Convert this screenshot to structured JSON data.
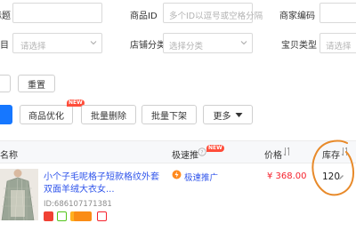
{
  "filters": {
    "title_label": "标题",
    "product_id_label": "商品ID",
    "product_id_placeholder": "多个ID以逗号或空格分隔",
    "merchant_code_label": "商家编码",
    "category_label": "类目",
    "category_placeholder": "请选择",
    "shop_category_label": "店铺分类",
    "shop_category_placeholder": "选择分类",
    "baby_type_label": "宝贝类型",
    "baby_type_placeholder": "请选择",
    "reset_button": "重置"
  },
  "toolbar": {
    "optimize_button": "商品优化",
    "optimize_badge": "NEW",
    "batch_delete_button": "批量删除",
    "batch_unlist_button": "批量下架",
    "more_button": "更多"
  },
  "table": {
    "col_name": "商品名称",
    "col_express": "极速推",
    "col_express_badge": "NEW",
    "col_price": "价格",
    "col_stock": "库存",
    "rows": [
      {
        "title_line1": "小个子毛呢格子短款格纹外套",
        "title_line2": "双面羊绒大衣女...",
        "id": "ID:686107171381",
        "express_link": "极速推广",
        "price": "¥ 368.00",
        "stock": "120"
      }
    ]
  },
  "colors": {
    "primary_blue": "#1677ff",
    "link_blue": "#2f54eb",
    "price_red": "#f5222d",
    "annotation_orange": "#e88a2a"
  }
}
